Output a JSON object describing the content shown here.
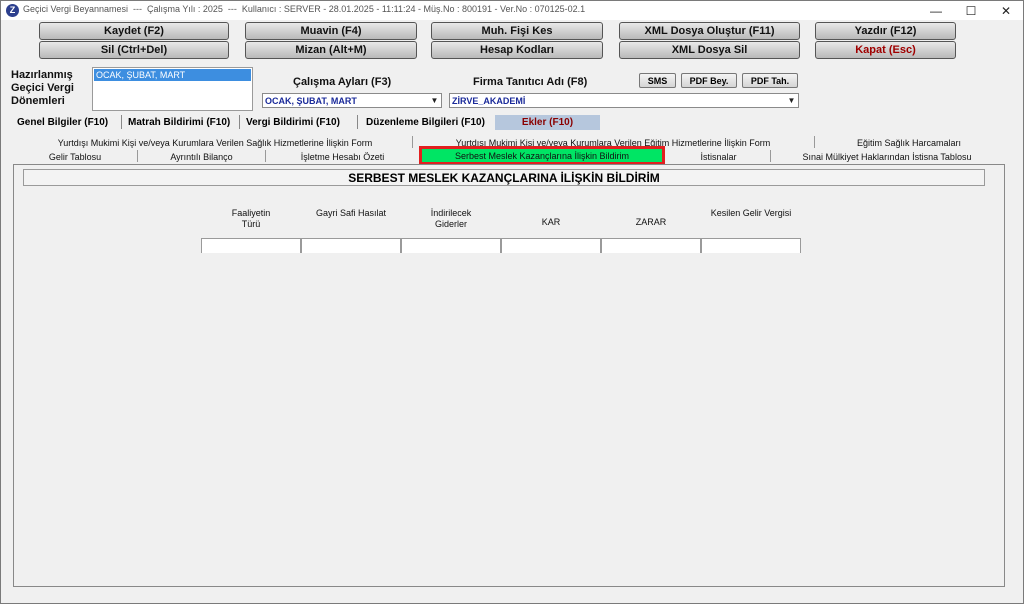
{
  "window": {
    "title": "Geçici Vergi Beyannamesi  ---  Çalışma Yılı : 2025  ---  Kullanıcı : SERVER - 28.01.2025 - 11:11:24 - Müş.No : 800191 - Ver.No : 070125-02.1",
    "controls": [
      "—",
      "☐",
      "✕"
    ]
  },
  "toolbar": {
    "row1": [
      "Kaydet (F2)",
      "Muavin (F4)",
      "Muh. Fişi Kes",
      "XML Dosya Oluştur (F11)",
      "Yazdır (F12)"
    ],
    "row2": [
      "Sil (Ctrl+Del)",
      "Mizan (Alt+M)",
      "Hesap Kodları",
      "XML Dosya Sil",
      "Kapat (Esc)"
    ]
  },
  "periods": {
    "label_lines": [
      "Hazırlanmış",
      "Geçici Vergi",
      "Dönemleri"
    ],
    "selected": "OCAK, ŞUBAT, MART"
  },
  "calisma_aylari": {
    "label": "Çalışma Ayları (F3)",
    "value": "OCAK, ŞUBAT, MART"
  },
  "firma": {
    "label": "Firma Tanıtıcı Adı (F8)",
    "value": "ZİRVE_AKADEMİ"
  },
  "small_buttons": [
    "SMS",
    "PDF Bey.",
    "PDF Tah."
  ],
  "main_tabs": [
    "Genel Bilgiler (F10)",
    "Matrah Bildirimi (F10)",
    "Vergi Bildirimi (F10)",
    "Düzenleme Bilgileri  (F10)",
    "Ekler (F10)"
  ],
  "sub_tabs_row1": [
    "Yurtdışı Mukimi Kişi ve/veya Kurumlara Verilen Sağlık Hizmetlerine İlişkin Form",
    "Yurtdışı Mukimi Kişi ve/veya Kurumlara Verilen Eğitim Hizmetlerine İlişkin Form",
    "Eğitim Sağlık Harcamaları"
  ],
  "sub_tabs_row2": [
    "Gelir Tablosu",
    "Ayrıntılı Bilanço",
    "İşletme Hesabı Özeti",
    "Serbest Meslek Kazançlarına İlişkin Bildirim",
    "İstisnalar",
    "Sınai Mülkiyet Haklarından İstisna Tablosu"
  ],
  "form": {
    "title": "SERBEST MESLEK KAZANÇLARINA İLİŞKİN BİLDİRİM",
    "columns": [
      [
        "Faaliyetin",
        "Türü"
      ],
      [
        "Gayri Safi Hasılat"
      ],
      [
        "İndirilecek",
        "Giderler"
      ],
      [
        "KAR"
      ],
      [
        "ZARAR"
      ],
      [
        "Kesilen Gelir Vergisi"
      ]
    ]
  },
  "colors": {
    "active_subtab": "#00e564",
    "highlight_border": "#e22020",
    "ekler_tab": "#b6c7dd",
    "selection": "#3d8ee0"
  }
}
